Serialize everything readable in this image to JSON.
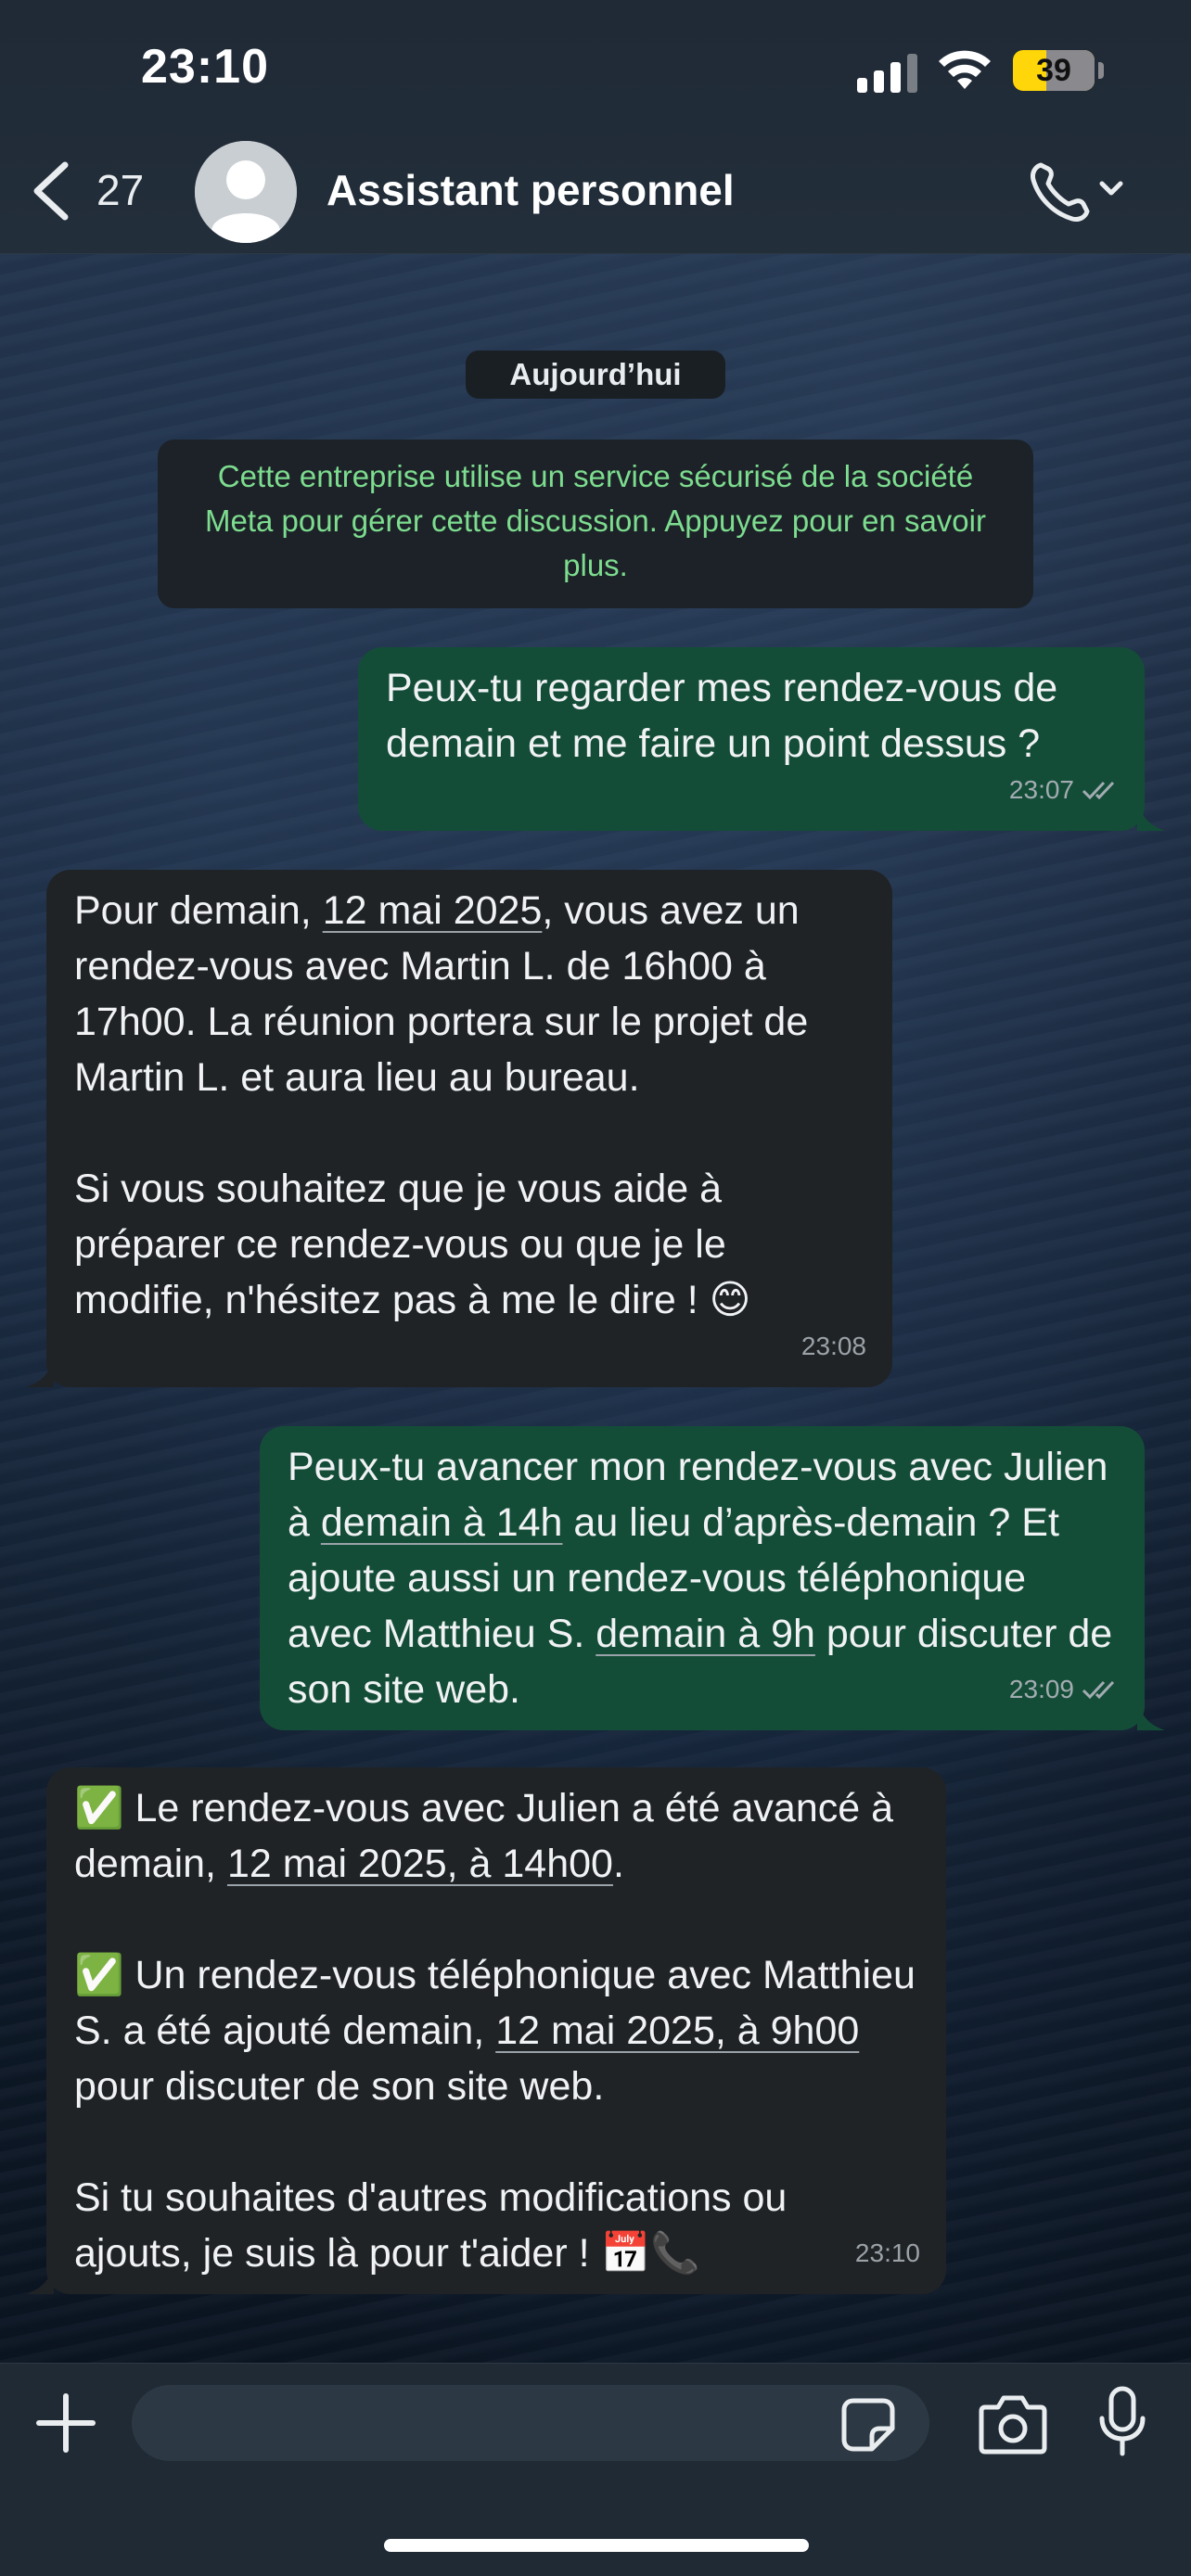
{
  "status_bar": {
    "time": "23:10",
    "battery": "39"
  },
  "header": {
    "back_count": "27",
    "contact_name": "Assistant personnel"
  },
  "chat": {
    "date_label": "Aujourd’hui",
    "notice": "Cette entreprise utilise un service sécurisé de la société Meta pour gérer cette discussion. Appuyez pour en savoir plus.",
    "messages": [
      {
        "direction": "outgoing",
        "text": "Peux-tu regarder mes rendez-vous de demain et me faire un point dessus ?",
        "time": "23:07",
        "status": "read"
      },
      {
        "direction": "incoming",
        "p1_a": "Pour demain, ",
        "p1_link": "12 mai 2025",
        "p1_b": ", vous avez un rendez-vous avec Martin L. de 16h00 à 17h00. La réunion portera sur le projet de Martin L. et aura lieu au bureau.",
        "p2": "Si vous souhaitez que je vous aide à préparer ce rendez-vous ou que je le modifie, n'hésitez pas à me le dire ! 😊",
        "time": "23:08"
      },
      {
        "direction": "outgoing",
        "a": "Peux-tu avancer mon rendez-vous avec Julien à ",
        "link1": "demain à 14h",
        "b": " au lieu d’après-demain ? Et ajoute aussi un rendez-vous téléphonique avec Matthieu S. ",
        "link2": "demain à 9h",
        "c": " pour discuter de son site web.",
        "time": "23:09",
        "status": "read"
      },
      {
        "direction": "incoming",
        "l1_a": "✅ Le rendez-vous avec Julien a été avancé à demain, ",
        "l1_link": "12 mai 2025, à 14h00",
        "l1_b": ".",
        "l2_a": "✅ Un rendez-vous téléphonique avec Matthieu S. a été ajouté demain, ",
        "l2_link": "12 mai 2025, à 9h00",
        "l2_b": " pour discuter de son site web.",
        "l3": "Si tu souhaites d'autres modifications ou ajouts, je suis là pour t'aider ! 📅📞",
        "time": "23:10"
      }
    ]
  },
  "composer": {
    "placeholder": ""
  },
  "colors": {
    "outgoing_bubble": "#144d37",
    "incoming_bubble": "#202326",
    "notice_text": "#7ddc8f",
    "battery": "#ffd60a"
  },
  "icons": [
    "back-chevron-icon",
    "avatar-placeholder-icon",
    "phone-icon",
    "chevron-down-icon",
    "plus-icon",
    "sticker-icon",
    "camera-icon",
    "microphone-icon",
    "double-check-icon",
    "signal-icon",
    "wifi-icon",
    "battery-icon"
  ]
}
